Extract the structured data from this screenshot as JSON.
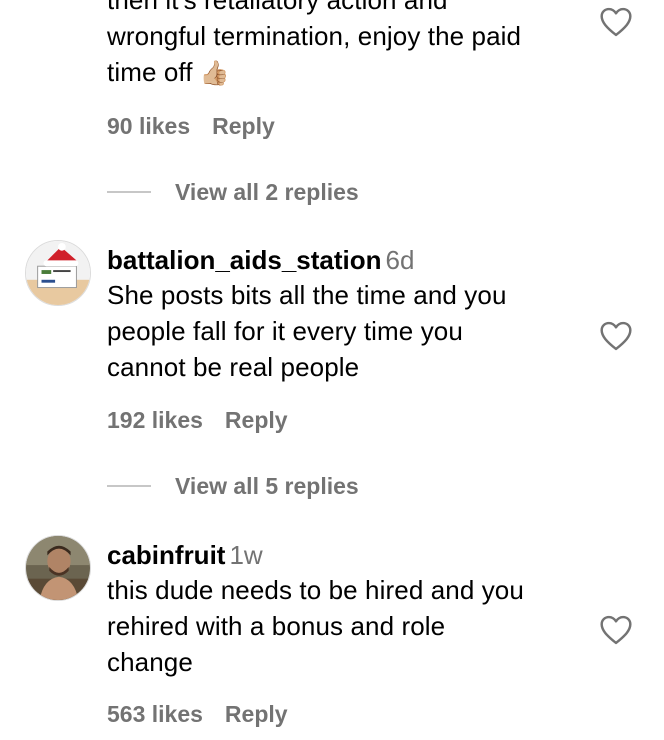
{
  "comments": [
    {
      "username": "",
      "timeago": "",
      "lines": [
        "then it's retaliatory action and",
        "wrongful termination, enjoy the paid",
        "time off"
      ],
      "emoji": "👍🏼",
      "likes": "90 likes",
      "reply_label": "Reply",
      "view_replies": "View all 2 replies"
    },
    {
      "username": "battalion_aids_station",
      "timeago": "6d",
      "lines": [
        "She posts bits all the time and you",
        "people fall for it every time you",
        "cannot be real people"
      ],
      "likes": "192 likes",
      "reply_label": "Reply",
      "view_replies": "View all 5 replies"
    },
    {
      "username": "cabinfruit",
      "timeago": "1w",
      "lines": [
        "this dude needs to be hired and you",
        "rehired with a bonus and role",
        "change"
      ],
      "likes": "563 likes",
      "reply_label": "Reply"
    }
  ],
  "icons": {
    "heart": "heart-outline-icon",
    "avatar1": "avatar-santa-hat",
    "avatar2": "avatar-photo"
  },
  "colors": {
    "text": "#000000",
    "secondary": "#737373",
    "divider": "#c7c7c7"
  }
}
